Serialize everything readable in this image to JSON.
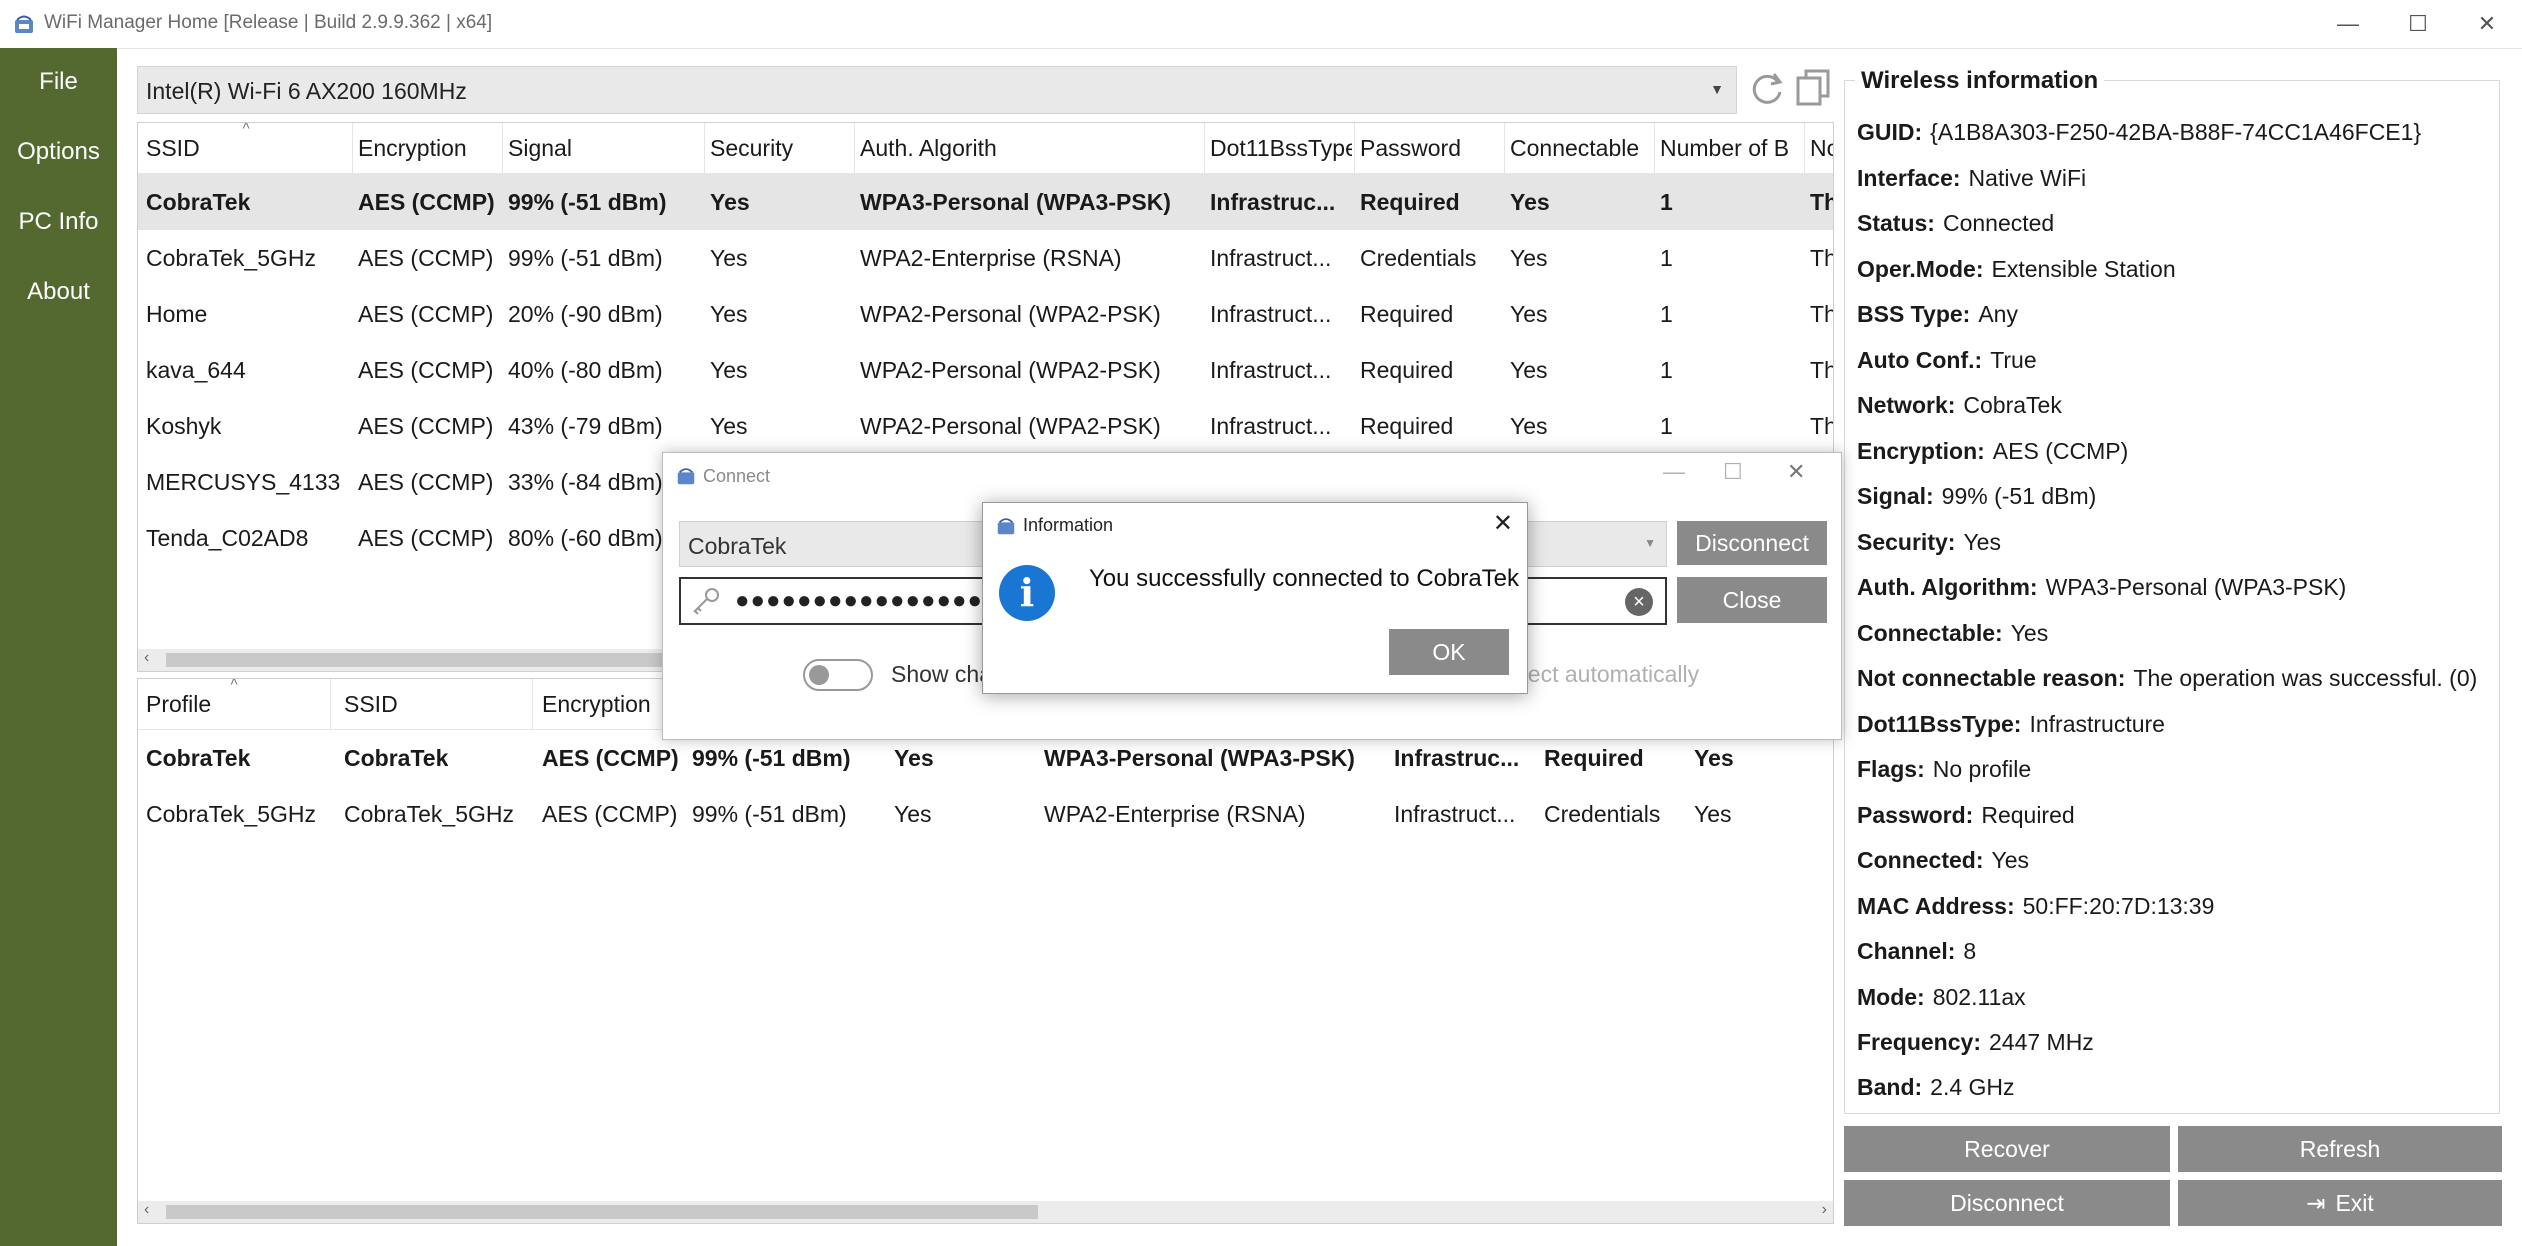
{
  "window": {
    "title": "WiFi Manager Home [Release | Build 2.9.9.362 | x64]",
    "minimize": "—",
    "maximize": "☐",
    "close": "✕"
  },
  "sidebar": {
    "items": [
      {
        "label": "File"
      },
      {
        "label": "Options"
      },
      {
        "label": "PC Info"
      },
      {
        "label": "About"
      }
    ]
  },
  "adapter": {
    "selected": "Intel(R) Wi-Fi 6 AX200 160MHz"
  },
  "networks": {
    "columns": [
      "SSID",
      "Encryption",
      "Signal",
      "Security",
      "Auth. Algorith",
      "Dot11BssType",
      "Password",
      "Connectable",
      "Number of B",
      "No"
    ],
    "rows": [
      [
        "CobraTek",
        "AES (CCMP)",
        "99% (-51 dBm)",
        "Yes",
        "WPA3-Personal (WPA3-PSK)",
        "Infrastruc...",
        "Required",
        "Yes",
        "1",
        "Th"
      ],
      [
        "CobraTek_5GHz",
        "AES (CCMP)",
        "99% (-51 dBm)",
        "Yes",
        "WPA2-Enterprise (RSNA)",
        "Infrastruct...",
        "Credentials",
        "Yes",
        "1",
        "Th"
      ],
      [
        "Home",
        "AES (CCMP)",
        "20% (-90 dBm)",
        "Yes",
        "WPA2-Personal (WPA2-PSK)",
        "Infrastruct...",
        "Required",
        "Yes",
        "1",
        "Th"
      ],
      [
        "kava_644",
        "AES (CCMP)",
        "40% (-80 dBm)",
        "Yes",
        "WPA2-Personal (WPA2-PSK)",
        "Infrastruct...",
        "Required",
        "Yes",
        "1",
        "Th"
      ],
      [
        "Koshyk",
        "AES (CCMP)",
        "43% (-79 dBm)",
        "Yes",
        "WPA2-Personal (WPA2-PSK)",
        "Infrastruct...",
        "Required",
        "Yes",
        "1",
        "Th"
      ],
      [
        "MERCUSYS_4133",
        "AES (CCMP)",
        "33% (-84 dBm)",
        "",
        "",
        "",
        "",
        "",
        "",
        ""
      ],
      [
        "Tenda_C02AD8",
        "AES (CCMP)",
        "80% (-60 dBm)",
        "",
        "",
        "",
        "",
        "",
        "",
        ""
      ]
    ]
  },
  "profiles": {
    "columns": [
      "Profile",
      "SSID",
      "Encryption"
    ],
    "rows": [
      [
        "CobraTek",
        "CobraTek",
        "AES (CCMP)",
        "99% (-51 dBm)",
        "Yes",
        "WPA3-Personal (WPA3-PSK)",
        "Infrastruc...",
        "Required",
        "Yes"
      ],
      [
        "CobraTek_5GHz",
        "CobraTek_5GHz",
        "AES (CCMP)",
        "99% (-51 dBm)",
        "Yes",
        "WPA2-Enterprise (RSNA)",
        "Infrastruct...",
        "Credentials",
        "Yes"
      ]
    ]
  },
  "wireless_info": {
    "title": "Wireless information",
    "items": [
      {
        "label": "GUID:",
        "value": "{A1B8A303-F250-42BA-B88F-74CC1A46FCE1}"
      },
      {
        "label": "Interface:",
        "value": "Native WiFi"
      },
      {
        "label": "Status:",
        "value": "Connected"
      },
      {
        "label": "Oper.Mode:",
        "value": "Extensible Station"
      },
      {
        "label": "BSS Type:",
        "value": "Any"
      },
      {
        "label": "Auto Conf.:",
        "value": "True"
      },
      {
        "label": "Network:",
        "value": "CobraTek"
      },
      {
        "label": "Encryption:",
        "value": "AES (CCMP)"
      },
      {
        "label": "Signal:",
        "value": "99% (-51 dBm)"
      },
      {
        "label": "Security:",
        "value": "Yes"
      },
      {
        "label": "Auth. Algorithm:",
        "value": "WPA3-Personal (WPA3-PSK)"
      },
      {
        "label": "Connectable:",
        "value": "Yes"
      },
      {
        "label": "Not connectable reason:",
        "value": "The operation was successful. (0)"
      },
      {
        "label": "Dot11BssType:",
        "value": "Infrastructure"
      },
      {
        "label": "Flags:",
        "value": "No profile"
      },
      {
        "label": "Password:",
        "value": "Required"
      },
      {
        "label": "Connected:",
        "value": "Yes"
      },
      {
        "label": "MAC Address:",
        "value": "50:FF:20:7D:13:39"
      },
      {
        "label": "Channel:",
        "value": "8"
      },
      {
        "label": "Mode:",
        "value": "802.11ax"
      },
      {
        "label": "Frequency:",
        "value": "2447 MHz"
      },
      {
        "label": "Band:",
        "value": "2.4 GHz"
      }
    ]
  },
  "buttons": {
    "recover": "Recover",
    "refresh": "Refresh",
    "disconnect": "Disconnect",
    "exit": "Exit"
  },
  "connect_dialog": {
    "title": "Connect",
    "network": "CobraTek",
    "password_masked": "●●●●●●●●●●●●●●●●",
    "disconnect": "Disconnect",
    "close": "Close",
    "show_chars": "Show cha",
    "connect_auto": "nect automatically",
    "show_chars_on": false
  },
  "info_dialog": {
    "title": "Information",
    "message": "You successfully connected to CobraTek",
    "ok": "OK",
    "close": "✕",
    "icon_glyph": "i"
  },
  "colors": {
    "sidebar": "#54692f",
    "button": "#8a8a8a",
    "selected_row": "#e5e5e5",
    "info_icon": "#1976d2"
  }
}
